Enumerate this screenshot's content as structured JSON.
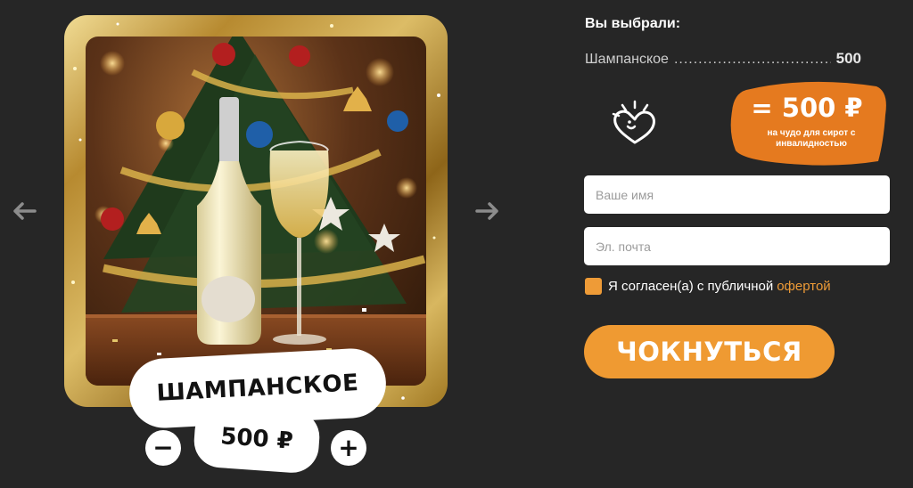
{
  "carousel": {
    "prev_icon": "arrow-left-icon",
    "next_icon": "arrow-right-icon"
  },
  "product": {
    "title": "ШАМПАНСКОЕ",
    "price": "500 ₽",
    "minus_label": "−",
    "plus_label": "+"
  },
  "summary": {
    "heading": "Вы выбрали:",
    "item_name": "Шампанское",
    "item_value": "500"
  },
  "charity": {
    "icon": "heart-sparkle-icon",
    "amount": "= 500 ₽",
    "note": "на чудо для сирот с инвалидностью"
  },
  "form": {
    "name_placeholder": "Ваше имя",
    "email_placeholder": "Эл. почта",
    "agree_text": "Я согласен(а) с публичной",
    "agree_link": "офертой",
    "submit_label": "ЧОКНУТЬСЯ"
  },
  "colors": {
    "background": "#262626",
    "accent": "#ef9a32",
    "gold_frame": "#c9a24a"
  }
}
